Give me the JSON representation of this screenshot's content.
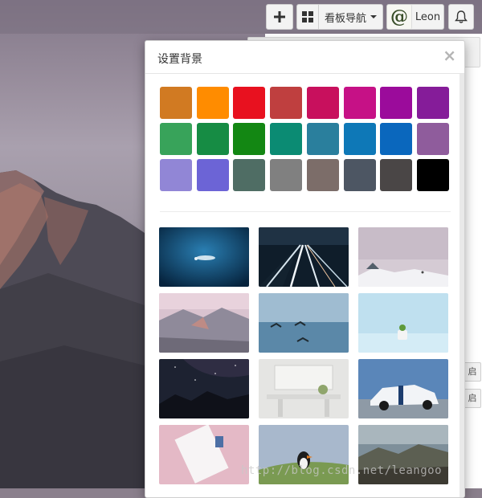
{
  "toolbar": {
    "add_icon": "plus-icon",
    "board_nav_label": "看板导航",
    "board_icon": "grid-icon",
    "user_name": "Leon",
    "avatar_glyph": "@",
    "bell_icon": "bell-icon"
  },
  "modal": {
    "title": "设置背景",
    "close_label": "×"
  },
  "colors": [
    "#d17a22",
    "#ff8c00",
    "#e8111f",
    "#bf3f3f",
    "#c8105d",
    "#c61186",
    "#9b0b9b",
    "#851c99",
    "#38a35a",
    "#168c44",
    "#138713",
    "#0b8b73",
    "#2a7f9d",
    "#0e78b7",
    "#0a67bd",
    "#8f5c9c",
    "#9186d6",
    "#6c64d6",
    "#4f6d64",
    "#808080",
    "#7c6d69",
    "#4d5663",
    "#4a4646",
    "#000000"
  ],
  "backgrounds": [
    {
      "name": "underwater-diver"
    },
    {
      "name": "night-highway-light-trails"
    },
    {
      "name": "snowy-landscape"
    },
    {
      "name": "pink-mountain-sunrise"
    },
    {
      "name": "birds-over-lake"
    },
    {
      "name": "small-plant-minimal"
    },
    {
      "name": "starry-night-forest"
    },
    {
      "name": "white-interior-room"
    },
    {
      "name": "white-sports-car"
    },
    {
      "name": "pink-notebook-desk"
    },
    {
      "name": "puffin-on-grass"
    },
    {
      "name": "misty-mountain-valley"
    }
  ],
  "background_side_buttons": [
    "启",
    "启"
  ],
  "watermark": "http://blog.csdn.net/leangoo"
}
